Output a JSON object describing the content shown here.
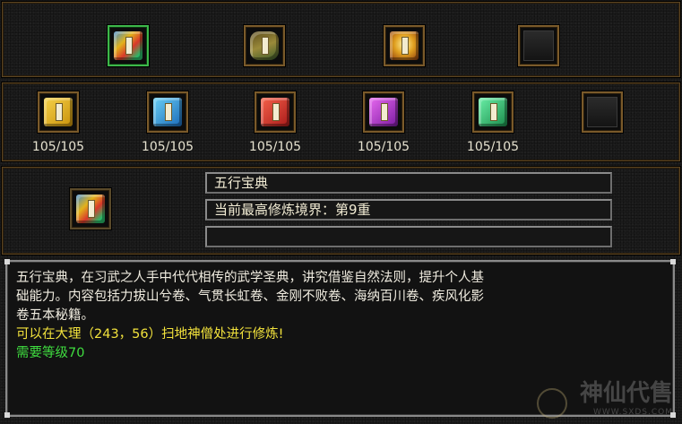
{
  "top_row": {
    "items": [
      {
        "name": "wuxing-baodian-book-icon",
        "selected": true,
        "color": "#c8922a"
      },
      {
        "name": "scroll-bundle-icon",
        "selected": false,
        "color": "#7a6a2a"
      },
      {
        "name": "golden-treasure-icon",
        "selected": false,
        "color": "#d89a2a"
      },
      {
        "name": "empty-slot",
        "empty": true
      }
    ]
  },
  "books_row": {
    "items": [
      {
        "icon": "yellow-book-icon",
        "color": "#e2b21a",
        "count": "105/105"
      },
      {
        "icon": "blue-book-icon",
        "color": "#2a9ad8",
        "count": "105/105"
      },
      {
        "icon": "red-book-icon",
        "color": "#d8382a",
        "count": "105/105"
      },
      {
        "icon": "purple-book-icon",
        "color": "#b02ad0",
        "count": "105/105"
      },
      {
        "icon": "green-book-icon",
        "color": "#2ab868",
        "count": "105/105"
      },
      {
        "icon": "empty-slot",
        "empty": true
      }
    ]
  },
  "detail": {
    "name": "五行宝典",
    "realm": "当前最高修炼境界：第9重",
    "extra": ""
  },
  "description": {
    "line1": "五行宝典，在习武之人手中代代相传的武学圣典，讲究借鉴自然法则，提升个人基",
    "line2": "础能力。内容包括力拔山兮卷、气贯长虹卷、金刚不败卷、海纳百川卷、疾风化影",
    "line3": "卷五本秘籍。",
    "location": "可以在大理（243，56）扫地神僧处进行修炼!",
    "requirement": "需要等级70"
  },
  "watermark": {
    "logo": "神仙代售",
    "url": "WWW.SXDS.COM"
  },
  "colors": {
    "frame_gold": "#7a5a2a",
    "selected_green": "#3db84a",
    "text_yellow": "#f2e23c",
    "text_green": "#3fdc3f"
  }
}
